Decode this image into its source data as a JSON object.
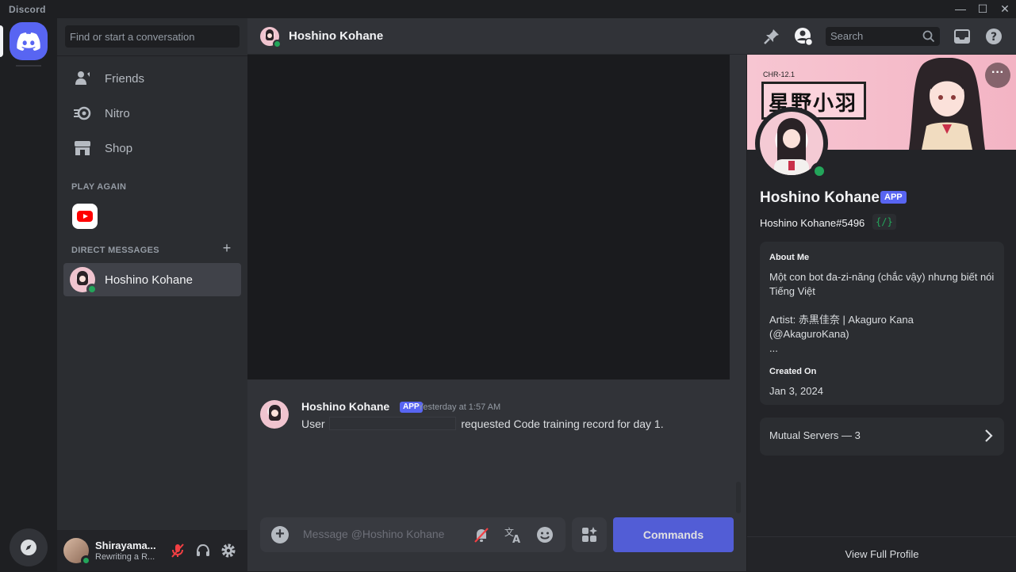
{
  "window": {
    "title": "Discord",
    "minimize": "—",
    "maximize": "☐",
    "close": "✕"
  },
  "rail": {
    "home_icon": "discord-logo-icon",
    "discover_icon": "compass-icon"
  },
  "sidebar": {
    "search_placeholder": "Find or start a conversation",
    "nav": [
      {
        "label": "Friends",
        "icon": "friends-icon"
      },
      {
        "label": "Nitro",
        "icon": "nitro-icon"
      },
      {
        "label": "Shop",
        "icon": "shop-icon"
      }
    ],
    "play_again_title": "PLAY AGAIN",
    "play_again_icon": "youtube-icon",
    "dm_title": "DIRECT MESSAGES",
    "dm_add": "+",
    "dms": [
      {
        "name": "Hoshino Kohane",
        "status": "online"
      }
    ]
  },
  "user_panel": {
    "name": "Shirayama...",
    "status_text": "Rewriting a R..."
  },
  "chat": {
    "header_title": "Hoshino Kohane",
    "message": {
      "author": "Hoshino Kohane",
      "badge": "APP",
      "time": "Yesterday at 1:57 AM",
      "text_before": "User",
      "text_after": "requested Code training record for day 1."
    },
    "composer_placeholder": "Message @Hoshino Kohane",
    "commands_label": "Commands"
  },
  "toolbar": {
    "search_placeholder": "Search"
  },
  "profile": {
    "banner_code": "CHR-12.1",
    "banner_title": "星野小羽",
    "more": "···",
    "name": "Hoshino Kohane",
    "badge": "APP",
    "tag": "Hoshino Kohane#5496",
    "dev_badge": "{/}",
    "about_title": "About Me",
    "about_line1": "Một con bot đa-zi-năng (chắc vậy) nhưng biết nói Tiếng Việt",
    "about_line2": "Artist: 赤黒佳奈 | Akaguro Kana (@AkaguroKana)",
    "about_line3": "...",
    "created_title": "Created On",
    "created_value": "Jan 3, 2024",
    "mutual_servers": "Mutual Servers — 3",
    "view_full": "View Full Profile"
  },
  "colors": {
    "accent": "#5865f2",
    "online": "#23a55a",
    "background": "#313338",
    "sidebar": "#2b2d31"
  }
}
